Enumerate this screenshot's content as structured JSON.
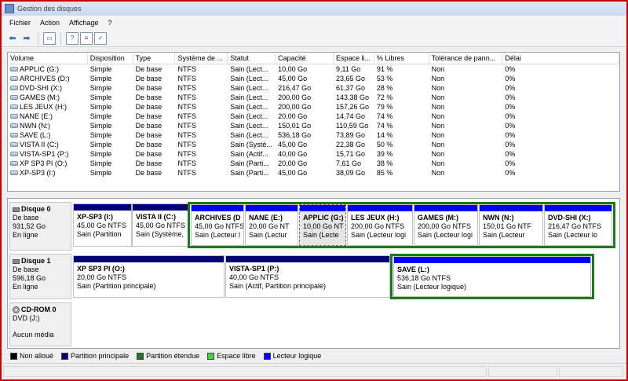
{
  "window": {
    "title": "Gestion des disques"
  },
  "menu": [
    "Fichier",
    "Action",
    "Affichage",
    "?"
  ],
  "columns": [
    "Volume",
    "Disposition",
    "Type",
    "Système de ...",
    "Statut",
    "Capacité",
    "Espace li...",
    "% Libres",
    "Tolérance de pann...",
    "Délai"
  ],
  "volumes": [
    [
      "APPLIC (G:)",
      "Simple",
      "De base",
      "NTFS",
      "Sain (Lect...",
      "10,00 Go",
      "9,11 Go",
      "91 %",
      "Non",
      "0%"
    ],
    [
      "ARCHIVES (D:)",
      "Simple",
      "De base",
      "NTFS",
      "Sain (Lect...",
      "45,00 Go",
      "23,65 Go",
      "53 %",
      "Non",
      "0%"
    ],
    [
      "DVD-SHI (X:)",
      "Simple",
      "De base",
      "NTFS",
      "Sain (Lect...",
      "216,47 Go",
      "61,37 Go",
      "28 %",
      "Non",
      "0%"
    ],
    [
      "GAMES (M:)",
      "Simple",
      "De base",
      "NTFS",
      "Sain (Lect...",
      "200,00 Go",
      "143,38 Go",
      "72 %",
      "Non",
      "0%"
    ],
    [
      "LES JEUX (H:)",
      "Simple",
      "De base",
      "NTFS",
      "Sain (Lect...",
      "200,00 Go",
      "157,26 Go",
      "79 %",
      "Non",
      "0%"
    ],
    [
      "NANE (E:)",
      "Simple",
      "De base",
      "NTFS",
      "Sain (Lect...",
      "20,00 Go",
      "14,74 Go",
      "74 %",
      "Non",
      "0%"
    ],
    [
      "NWN (N:)",
      "Simple",
      "De base",
      "NTFS",
      "Sain (Lect...",
      "150,01 Go",
      "110,59 Go",
      "74 %",
      "Non",
      "0%"
    ],
    [
      "SAVE (L:)",
      "Simple",
      "De base",
      "NTFS",
      "Sain (Lect...",
      "536,18 Go",
      "73,89 Go",
      "14 %",
      "Non",
      "0%"
    ],
    [
      "VISTA II (C:)",
      "Simple",
      "De base",
      "NTFS",
      "Sain (Systè...",
      "45,00 Go",
      "22,38 Go",
      "50 %",
      "Non",
      "0%"
    ],
    [
      "VISTA-SP1 (P:)",
      "Simple",
      "De base",
      "NTFS",
      "Sain (Actif...",
      "40,00 Go",
      "15,71 Go",
      "39 %",
      "Non",
      "0%"
    ],
    [
      "XP SP3 PI (O:)",
      "Simple",
      "De base",
      "NTFS",
      "Sain (Parti...",
      "20,00 Go",
      "7,61 Go",
      "38 %",
      "Non",
      "0%"
    ],
    [
      "XP-SP3 (I:)",
      "Simple",
      "De base",
      "NTFS",
      "Sain (Parti...",
      "45,00 Go",
      "38,09 Go",
      "85 %",
      "Non",
      "0%"
    ]
  ],
  "disks": [
    {
      "name": "Disque 0",
      "type": "De base",
      "size": "931,52 Go",
      "status": "En ligne",
      "partitions": [
        {
          "name": "XP-SP3  (I:)",
          "size": "45,00 Go NTFS",
          "status": "Sain (Partition"
        },
        {
          "name": "VISTA II  (C:)",
          "size": "45,00 Go NTFS",
          "status": "Sain (Système,"
        },
        {
          "name": "ARCHIVES  (D",
          "size": "45,00 Go NTFS",
          "status": "Sain (Lecteur l"
        },
        {
          "name": "NANE  (E:)",
          "size": "20,00 Go NT",
          "status": "Sain (Lectur"
        },
        {
          "name": "APPLIC  (G:)",
          "size": "10,00 Go NT",
          "status": "Sain (Lecte"
        },
        {
          "name": "LES JEUX  (H:)",
          "size": "200,00 Go NTFS",
          "status": "Sain (Lecteur logi"
        },
        {
          "name": "GAMES  (M:)",
          "size": "200,00 Go NTFS",
          "status": "Sain (Lecteur logi"
        },
        {
          "name": "NWN  (N:)",
          "size": "150,01 Go NTF",
          "status": "Sain (Lecteur"
        },
        {
          "name": "DVD-SHI  (X:)",
          "size": "216,47 Go NTFS",
          "status": "Sain (Lecteur lo"
        }
      ]
    },
    {
      "name": "Disque 1",
      "type": "De base",
      "size": "596,18 Go",
      "status": "En ligne",
      "partitions": [
        {
          "name": "XP SP3 PI  (O:)",
          "size": "20,00 Go NTFS",
          "status": "Sain (Partition principale)"
        },
        {
          "name": "VISTA-SP1  (P:)",
          "size": "40,00 Go NTFS",
          "status": "Sain (Actif, Partition principale)"
        },
        {
          "name": "SAVE  (L:)",
          "size": "536,18 Go NTFS",
          "status": "Sain (Lecteur logique)"
        }
      ]
    },
    {
      "name": "CD-ROM 0",
      "type": "DVD (J:)",
      "size": "",
      "status": "Aucun média",
      "partitions": []
    }
  ],
  "legend": [
    {
      "label": "Non alloué",
      "color": "#000000"
    },
    {
      "label": "Partition principale",
      "color": "#00007b"
    },
    {
      "label": "Partition étendue",
      "color": "#1b7a1b"
    },
    {
      "label": "Espace libre",
      "color": "#33dd33"
    },
    {
      "label": "Lecteur logique",
      "color": "#0000ff"
    }
  ]
}
